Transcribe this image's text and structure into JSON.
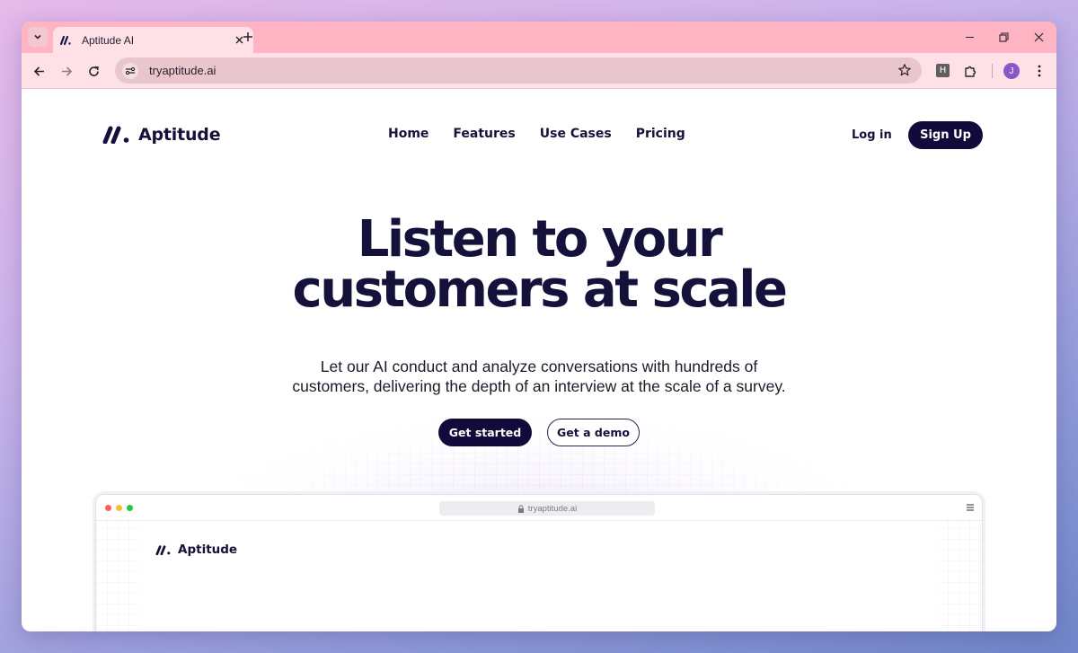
{
  "browser": {
    "tab_title": "Aptitude AI",
    "url": "tryaptitude.ai",
    "extension_label": "H",
    "profile_initial": "J",
    "icons": [
      "tab-search-icon",
      "close-icon",
      "plus-icon",
      "minimize-icon",
      "restore-icon",
      "back-icon",
      "forward-icon",
      "reload-icon",
      "site-info-icon",
      "star-icon",
      "puzzle-icon",
      "kebab-icon"
    ],
    "chrome_color": "#ffb4c3"
  },
  "site": {
    "brand": "Aptitude",
    "nav": {
      "home": "Home",
      "features": "Features",
      "use_cases": "Use Cases",
      "pricing": "Pricing"
    },
    "login": "Log in",
    "signup": "Sign Up",
    "hero": {
      "title_line1": "Listen to your",
      "title_line2": "customers at scale",
      "subtitle_line1": "Let our AI conduct and analyze conversations with hundreds of",
      "subtitle_line2": "customers, delivering the depth of an interview at the scale of a survey.",
      "cta_primary": "Get started",
      "cta_secondary": "Get a demo"
    },
    "preview": {
      "url": "tryaptitude.ai",
      "brand": "Aptitude"
    },
    "colors": {
      "primary": "#110a3b",
      "text": "#14123a"
    }
  }
}
